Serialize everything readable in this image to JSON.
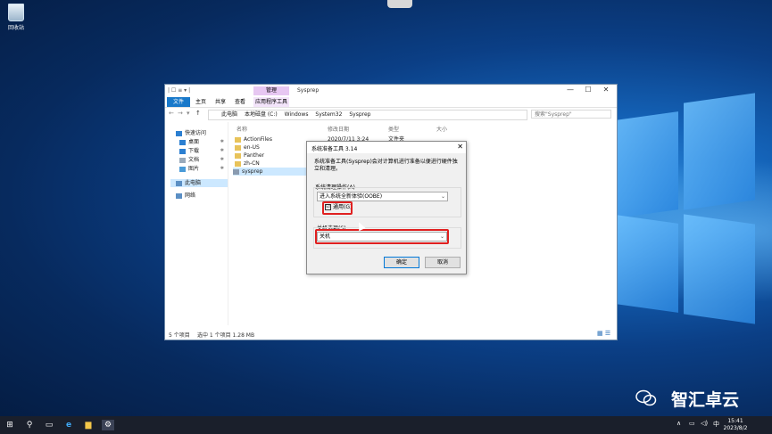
{
  "desktop": {
    "recycle_bin_label": "回收站",
    "watermark": "智汇卓云"
  },
  "explorer": {
    "qa_toolbar": "| ☐ ≡ ▾ |",
    "manage_tab": "管理",
    "title": "Sysprep",
    "controls": {
      "minimize": "—",
      "maximize": "☐",
      "close": "✕"
    },
    "ribbon_tabs": [
      "文件",
      "主页",
      "共享",
      "查看",
      "应用程序工具"
    ],
    "nav_buttons": {
      "back": "←",
      "forward": "→",
      "recent": "▾",
      "up": "↑"
    },
    "breadcrumb": [
      "此电脑",
      "本地磁盘 (C:)",
      "Windows",
      "System32",
      "Sysprep"
    ],
    "search_placeholder": "搜索\"Sysprep\"",
    "nav_pane": {
      "quick_access": "快速访问",
      "items": [
        "桌面",
        "下载",
        "文档",
        "图片"
      ],
      "this_pc": "此电脑",
      "network": "网络"
    },
    "columns": {
      "name": "名称",
      "modified": "修改日期",
      "type": "类型",
      "size": "大小"
    },
    "files": [
      {
        "name": "ActionFiles",
        "modified": "2020/7/11 3:24",
        "type": "文件夹"
      },
      {
        "name": "en-US",
        "modified": "",
        "type": ""
      },
      {
        "name": "Panther",
        "modified": "",
        "type": ""
      },
      {
        "name": "zh-CN",
        "modified": "",
        "type": ""
      },
      {
        "name": "sysprep",
        "modified": "",
        "type": ""
      }
    ],
    "status": {
      "count": "5 个项目",
      "selected": "选中 1 个项目  1.28 MB"
    }
  },
  "dialog": {
    "title": "系统准备工具 3.14",
    "close": "✕",
    "description": "系统准备工具(Sysprep)会对计算机进行准备以便进行硬件独立和清理。",
    "cleanup_label": "系统清理操作(A)",
    "cleanup_value": "进入系统全新体验(OOBE)",
    "generalize_label": "通用(G)",
    "generalize_checked": "☑",
    "shutdown_label": "关机选项(S)",
    "shutdown_value": "关机",
    "ok": "确定",
    "cancel": "取消"
  },
  "taskbar": {
    "start": "⊞",
    "search": "⚲",
    "taskview": "▭",
    "ie": "e",
    "explorer": "▆",
    "sysprep": "⚙",
    "tray_arrow": "∧",
    "tray_network": "▭",
    "tray_volume": "◁)",
    "ime": "中",
    "time": "15:41",
    "date": "2023/8/2"
  },
  "colors": {
    "accent": "#1979ca",
    "highlight_box": "#e02020",
    "selection": "#cce8ff"
  }
}
